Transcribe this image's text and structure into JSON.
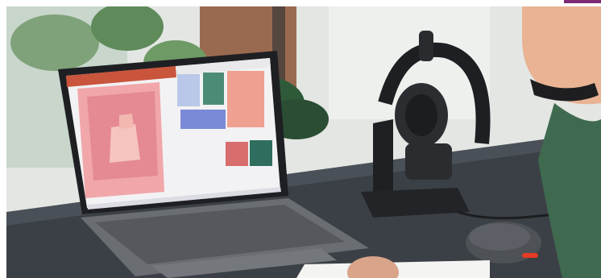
{
  "scene": {
    "description_icon": "photo-icon",
    "colors": {
      "accent_bar": "#7d2a76",
      "desk": "#3a3f45",
      "wall": "#dde2df",
      "slide_pink": "#e58a92",
      "mouse_accent": "#e53a24"
    }
  }
}
